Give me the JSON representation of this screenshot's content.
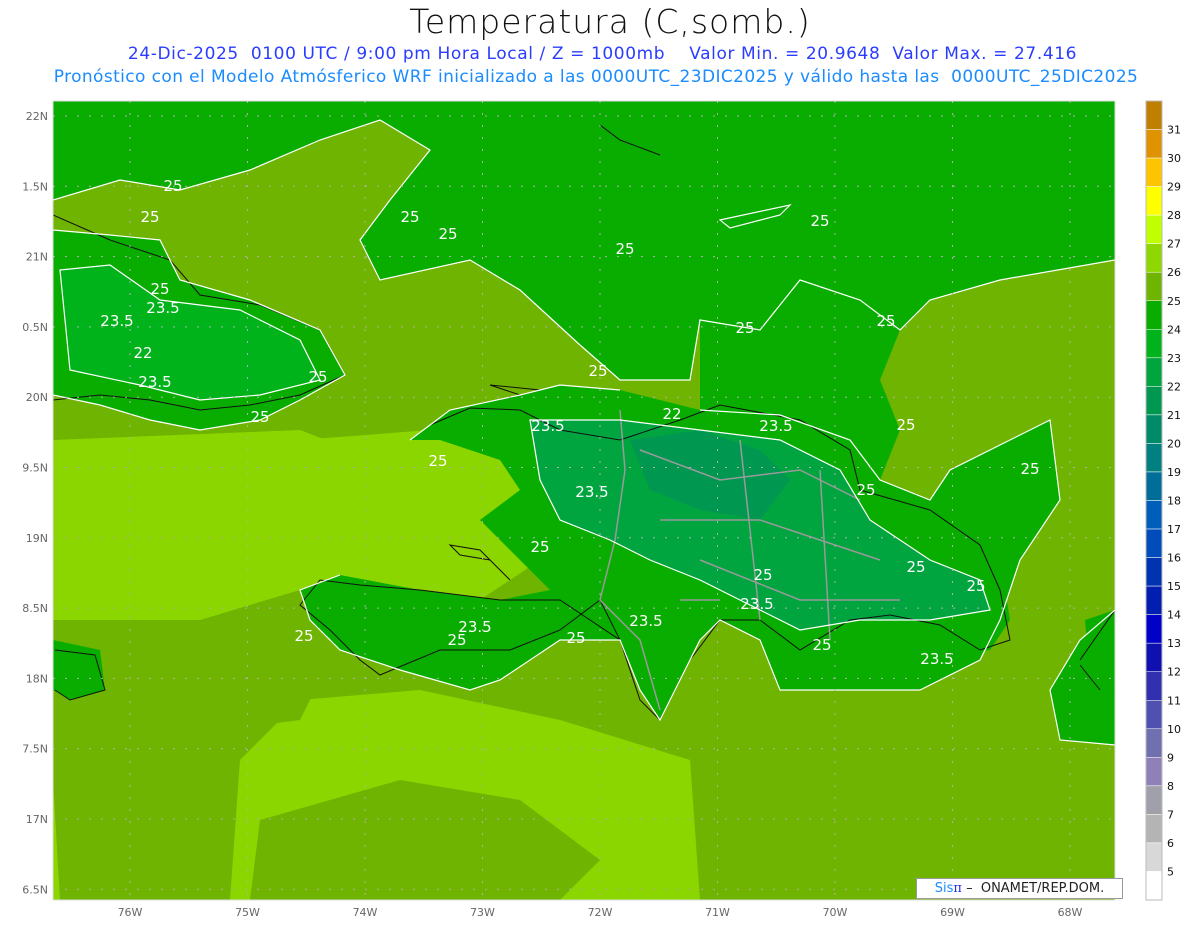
{
  "header": {
    "title": "Temperatura (C,somb.)",
    "line1": "24-Dic-2025  0100 UTC / 9:00 pm Hora Local / Z = 1000mb    Valor Min. = 20.9648  Valor Max. = 27.416",
    "line2": "Pronóstico con el Modelo Atmósferico WRF inicializado a las 0000UTC_23DIC2025 y válido hasta las  0000UTC_25DIC2025"
  },
  "map": {
    "variable": "Temperatura",
    "units": "C",
    "level": "1000mb",
    "valid_time": "24-Dic-2025 0100 UTC",
    "min_value": 20.9648,
    "max_value": 27.416,
    "lon_labels": [
      "76W",
      "75W",
      "74W",
      "73W",
      "72W",
      "71W",
      "70W",
      "69W",
      "68W"
    ],
    "lat_labels": [
      "22N",
      "1.5N",
      "21N",
      "0.5N",
      "20N",
      "9.5N",
      "19N",
      "8.5N",
      "18N",
      "7.5N",
      "17N",
      "6.5N"
    ],
    "contour_labels": [
      "25",
      "25",
      "25",
      "25",
      "25",
      "25",
      "25",
      "25",
      "23.5",
      "23.5",
      "22",
      "23.5",
      "25",
      "25",
      "25",
      "22",
      "23.5",
      "23.5",
      "23.5",
      "25",
      "25",
      "25",
      "25",
      "25",
      "25",
      "23.5",
      "25",
      "25",
      "23.5",
      "23.5",
      "25",
      "25",
      "25",
      "25",
      "23.5",
      "25"
    ],
    "colors": {
      "c24_25": "#08ad00",
      "c25_26": "#6fb400",
      "c26_27": "#8cd600",
      "c23_24": "#00b31a",
      "c22_23": "#00a540"
    }
  },
  "colorbar": {
    "labels": [
      "31",
      "30",
      "29",
      "28",
      "27",
      "26",
      "25",
      "24",
      "23",
      "22",
      "21",
      "20",
      "19",
      "18",
      "17",
      "16",
      "15",
      "14",
      "13",
      "12",
      "11",
      "10",
      "9",
      "8",
      "7",
      "6",
      "5"
    ],
    "colors": [
      "#bf7f00",
      "#df9300",
      "#ffc400",
      "#ffff00",
      "#bfff00",
      "#8fd700",
      "#6fb400",
      "#08ad00",
      "#00b31a",
      "#00a540",
      "#009850",
      "#008b68",
      "#008080",
      "#006e98",
      "#005ebb",
      "#004cbb",
      "#0033b0",
      "#001eb0",
      "#0000c8",
      "#1010b0",
      "#3030b0",
      "#5050b0",
      "#7070b0",
      "#9080b8",
      "#a0a0aa",
      "#b4b4b4",
      "#d8d8d8",
      "#ffffff"
    ]
  },
  "credit": {
    "brand": "Sis",
    "pi": "π",
    "text": " –  ONAMET/REP.DOM."
  }
}
